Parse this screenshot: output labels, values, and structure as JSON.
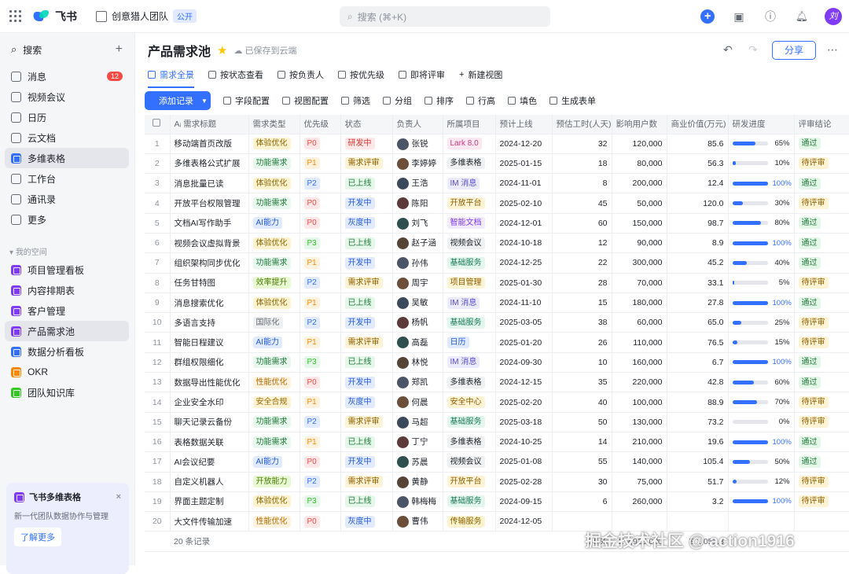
{
  "topbar": {
    "brand": "飞书",
    "team": "创意猎人团队",
    "team_badge": "公开",
    "search_placeholder": "搜索 (⌘+K)",
    "avatar": "刘"
  },
  "sidebar": {
    "search": "搜索",
    "items": [
      {
        "label": "消息",
        "icon": "chat-icon",
        "count": "12"
      },
      {
        "label": "视频会议",
        "icon": "video-icon"
      },
      {
        "label": "日历",
        "icon": "calendar-icon"
      },
      {
        "label": "云文档",
        "icon": "cloud-doc-icon"
      },
      {
        "label": "多维表格",
        "icon": "base-icon",
        "active": true
      },
      {
        "label": "工作台",
        "icon": "apps-icon"
      },
      {
        "label": "通讯录",
        "icon": "contacts-icon"
      },
      {
        "label": "更多",
        "icon": "more-icon"
      }
    ],
    "section": "我的空间",
    "spaces": [
      {
        "label": "项目管理看板",
        "color": "#7f3bf5"
      },
      {
        "label": "内容排期表",
        "color": "#7f3bf5"
      },
      {
        "label": "客户管理",
        "color": "#7f3bf5"
      },
      {
        "label": "产品需求池",
        "color": "#7f3bf5",
        "active": true
      },
      {
        "label": "数据分析看板",
        "color": "#3370ff"
      },
      {
        "label": "OKR",
        "color": "#ff8800"
      },
      {
        "label": "团队知识库",
        "color": "#34c724"
      }
    ],
    "promo": {
      "title": "飞书多维表格",
      "sub": "新一代团队数据协作与管理",
      "button": "了解更多"
    }
  },
  "header": {
    "title": "产品需求池",
    "saved": "已保存到云端",
    "share": "分享"
  },
  "tabs": [
    "需求全景",
    "按状态查看",
    "按负责人",
    "按优先级",
    "即将评审",
    "新建视图"
  ],
  "toolbar": {
    "add": "添加记录",
    "items": [
      "字段配置",
      "视图配置",
      "筛选",
      "分组",
      "排序",
      "行高",
      "填色",
      "生成表单"
    ]
  },
  "columns": [
    "需求标题",
    "需求类型",
    "优先级",
    "状态",
    "负责人",
    "所属项目",
    "预计上线",
    "预估工时(人天)",
    "影响用户数",
    "商业价值(万元)",
    "研发进度",
    "评审结论"
  ],
  "rows": [
    [
      "1",
      "移动端首页改版",
      "体验优化",
      "P0",
      "研发中",
      "张锐",
      "Lark 8.0",
      "2024-12-20",
      "32",
      "120,000",
      "85.6",
      "65%",
      "通过"
    ],
    [
      "2",
      "多维表格公式扩展",
      "功能需求",
      "P1",
      "需求评审",
      "李婷婷",
      "多维表格",
      "2025-01-15",
      "18",
      "80,000",
      "56.3",
      "10%",
      "待评审"
    ],
    [
      "3",
      "消息批量已读",
      "体验优化",
      "P2",
      "已上线",
      "王浩",
      "IM 消息",
      "2024-11-01",
      "8",
      "200,000",
      "12.4",
      "100%",
      "通过"
    ],
    [
      "4",
      "开放平台权限管理",
      "功能需求",
      "P0",
      "开发中",
      "陈阳",
      "开放平台",
      "2025-02-10",
      "45",
      "50,000",
      "120.0",
      "30%",
      "待评审"
    ],
    [
      "5",
      "文档AI写作助手",
      "AI能力",
      "P0",
      "灰度中",
      "刘飞",
      "智能文档",
      "2024-12-01",
      "60",
      "150,000",
      "98.7",
      "80%",
      "通过"
    ],
    [
      "6",
      "视频会议虚拟背景",
      "体验优化",
      "P3",
      "已上线",
      "赵子涵",
      "视频会议",
      "2024-10-18",
      "12",
      "90,000",
      "8.9",
      "100%",
      "通过"
    ],
    [
      "7",
      "组织架构同步优化",
      "功能需求",
      "P1",
      "开发中",
      "孙伟",
      "基础服务",
      "2024-12-25",
      "22",
      "300,000",
      "45.2",
      "40%",
      "通过"
    ],
    [
      "8",
      "任务甘特图",
      "效率提升",
      "P2",
      "需求评审",
      "周宇",
      "项目管理",
      "2025-01-30",
      "28",
      "70,000",
      "33.1",
      "5%",
      "待评审"
    ],
    [
      "9",
      "消息搜索优化",
      "体验优化",
      "P1",
      "已上线",
      "吴敏",
      "IM 消息",
      "2024-11-10",
      "15",
      "180,000",
      "27.8",
      "100%",
      "通过"
    ],
    [
      "10",
      "多语言支持",
      "国际化",
      "P2",
      "开发中",
      "杨帆",
      "基础服务",
      "2025-03-05",
      "38",
      "60,000",
      "65.0",
      "25%",
      "待评审"
    ],
    [
      "11",
      "智能日程建议",
      "AI能力",
      "P1",
      "需求评审",
      "高磊",
      "日历",
      "2025-01-20",
      "26",
      "110,000",
      "76.5",
      "15%",
      "待评审"
    ],
    [
      "12",
      "群组权限细化",
      "功能需求",
      "P3",
      "已上线",
      "林悦",
      "IM 消息",
      "2024-09-30",
      "10",
      "160,000",
      "6.7",
      "100%",
      "通过"
    ],
    [
      "13",
      "数据导出性能优化",
      "性能优化",
      "P0",
      "开发中",
      "郑凯",
      "多维表格",
      "2024-12-15",
      "35",
      "220,000",
      "42.8",
      "60%",
      "通过"
    ],
    [
      "14",
      "企业安全水印",
      "安全合规",
      "P1",
      "灰度中",
      "何晨",
      "安全中心",
      "2025-02-20",
      "40",
      "100,000",
      "88.9",
      "70%",
      "待评审"
    ],
    [
      "15",
      "聊天记录云备份",
      "功能需求",
      "P2",
      "需求评审",
      "马超",
      "基础服务",
      "2025-03-18",
      "50",
      "130,000",
      "73.2",
      "0%",
      "待评审"
    ],
    [
      "16",
      "表格数据关联",
      "功能需求",
      "P1",
      "已上线",
      "丁宁",
      "多维表格",
      "2024-10-25",
      "14",
      "210,000",
      "19.6",
      "100%",
      "通过"
    ],
    [
      "17",
      "AI会议纪要",
      "AI能力",
      "P0",
      "开发中",
      "苏晨",
      "视频会议",
      "2025-01-08",
      "55",
      "140,000",
      "105.4",
      "50%",
      "通过"
    ],
    [
      "18",
      "自定义机器人",
      "开放能力",
      "P2",
      "需求评审",
      "黄静",
      "开放平台",
      "2025-02-28",
      "30",
      "75,000",
      "51.7",
      "12%",
      "待评审"
    ],
    [
      "19",
      "界面主题定制",
      "体验优化",
      "P3",
      "已上线",
      "韩梅梅",
      "基础服务",
      "2024-09-15",
      "6",
      "260,000",
      "3.2",
      "100%",
      "待评审"
    ],
    [
      "20",
      "大文件传输加速",
      "性能优化",
      "P0",
      "灰度中",
      "曹伟",
      "传输服务",
      "2024-12-05",
      "",
      "",
      "",
      "",
      ""
    ]
  ],
  "footer": {
    "count": "20 条记录",
    "sum_hours": "Σ 555",
    "sum_users": "Σ 2,925,000",
    "sum_value": "Σ 1,051.3"
  },
  "watermark": "掘金技术社区 @ action1916",
  "colors": {
    "accent": "#3370ff",
    "P0": "#f54a45",
    "P1": "#ff8800",
    "P2": "#3370ff",
    "P3": "#34c724"
  }
}
